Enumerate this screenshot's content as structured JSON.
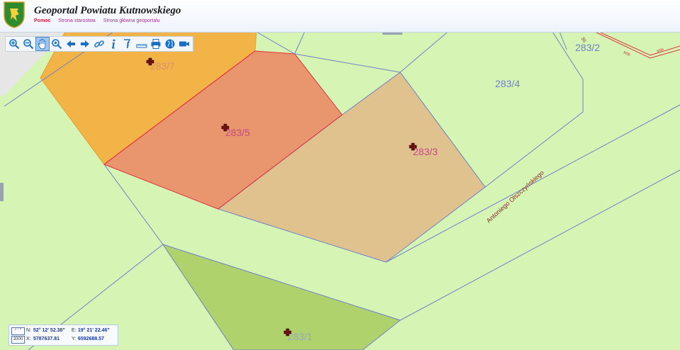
{
  "header": {
    "title": "Geoportal Powiatu Kutnowskiego",
    "links": [
      "Pomoc",
      "Strona starostwa",
      "Strona główna geoportalu"
    ]
  },
  "toolbar": {
    "tools": [
      "zoom-in",
      "zoom-out",
      "pan",
      "zoom-area",
      "back",
      "forward",
      "link",
      "info",
      "info-query",
      "measure",
      "print",
      "globe",
      "camera"
    ]
  },
  "map": {
    "parcels": [
      "283/7",
      "283/5",
      "283/3",
      "283/4",
      "283/2",
      "283/1"
    ],
    "street_label": "Antoniego Olszczyńskiego",
    "small_labels": [
      "36",
      "M35",
      "M36"
    ],
    "colors": {
      "background": "#d6f5b5",
      "orange": "#f2b446",
      "salmon": "#e9966e",
      "tan": "#dfc28e",
      "olive": "#b0d26c",
      "boundary": "#6f80c8",
      "red_line": "#e0323c"
    }
  },
  "coords": {
    "btn_top": "° ' \"",
    "btn_bottom": "2000",
    "n_label": "N:",
    "n_value": "52° 12' 52.38\"",
    "e_label": "E:",
    "e_value": "19° 21' 22.46\"",
    "x_label": "X:",
    "x_value": "5787637.81",
    "y_label": "Y:",
    "y_value": "6592688.57"
  }
}
